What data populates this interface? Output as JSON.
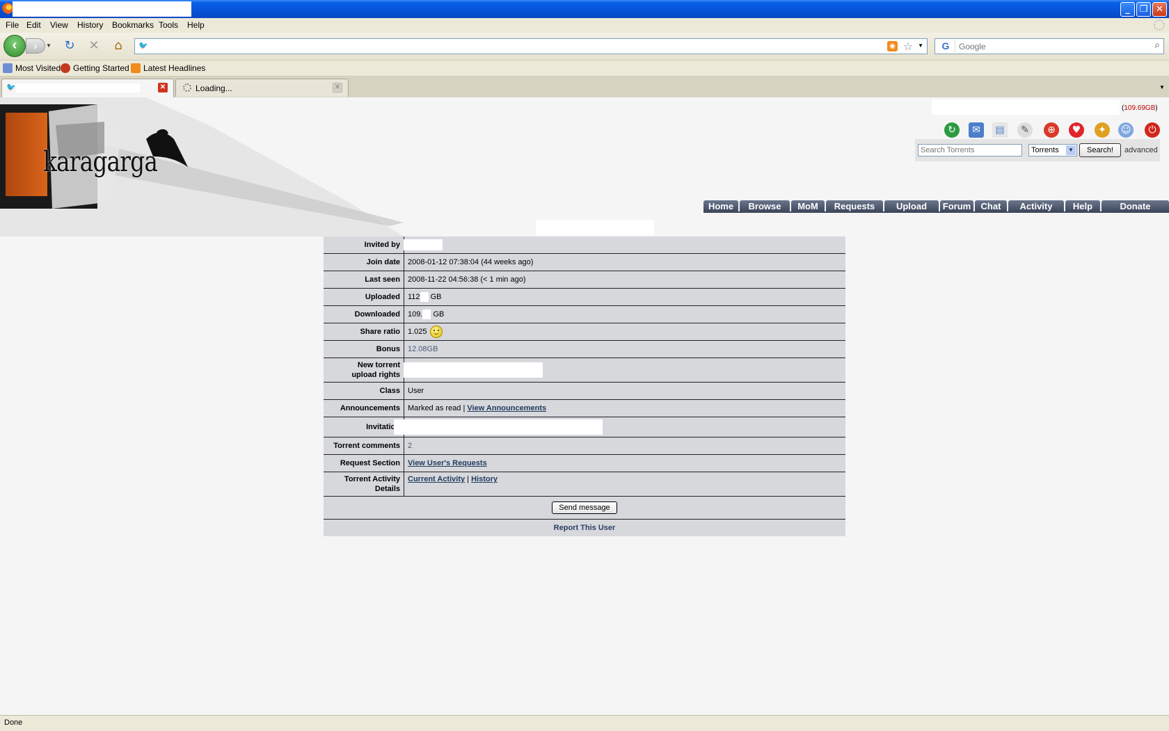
{
  "menu": [
    "File",
    "Edit",
    "View",
    "History",
    "Bookmarks",
    "Tools",
    "Help"
  ],
  "window_buttons": {
    "minimize": "_",
    "maximize": "❐",
    "close": "✕"
  },
  "nav": {
    "back": "‹",
    "forward": "›",
    "reload": "↻",
    "stop": "✕",
    "home": "⌂"
  },
  "search_placeholder": "Google",
  "bookmarks": [
    "Most Visited",
    "Getting Started",
    "Latest Headlines"
  ],
  "tabs": [
    {
      "label": ""
    },
    {
      "label": "Loading..."
    }
  ],
  "site": {
    "logo": "karagarga",
    "ratio_info": "109.69GB",
    "search_placeholder": "Search Torrents",
    "search_scope": "Torrents",
    "search_button": "Search!",
    "advanced": "advanced",
    "icons": [
      "refresh-icon",
      "bookmark-icon",
      "profile-card-icon",
      "messages-icon",
      "lifebuoy-icon",
      "heart-icon",
      "friends-icon",
      "users-icon",
      "logout-icon"
    ],
    "nav_tabs": [
      "Home",
      "Browse",
      "MoM",
      "Requests",
      "Upload",
      "Forum",
      "Chat",
      "Activity",
      "Help",
      "Donate"
    ]
  },
  "profile": {
    "invited_by_label": "Invited by",
    "join_date_label": "Join date",
    "join_date": "2008-01-12 07:38:04 (44 weeks ago)",
    "last_seen_label": "Last seen",
    "last_seen": "2008-11-22 04:56:38 (< 1 min ago)",
    "uploaded_label": "Uploaded",
    "uploaded_prefix": "112",
    "uploaded_unit": "GB",
    "downloaded_label": "Downloaded",
    "downloaded_prefix": "109.",
    "downloaded_unit": "GB",
    "share_ratio_label": "Share ratio",
    "share_ratio": "1.025",
    "bonus_label": "Bonus",
    "bonus": "12.08GB",
    "upload_rights_label_1": "New torrent",
    "upload_rights_label_2": "upload rights",
    "class_label": "Class",
    "class": "User",
    "announcements_label": "Announcements",
    "announcements_status": "Marked as read |",
    "announcements_link": "View Announcements",
    "invitation_label": "Invitation",
    "torrent_comments_label": "Torrent comments",
    "torrent_comments": "2",
    "request_section_label": "Request Section",
    "request_section_link": "View User's Requests",
    "activity_label_1": "Torrent Activity",
    "activity_label_2": "Details",
    "activity_current": "Current Activity",
    "activity_sep": "|",
    "activity_history": "History",
    "send_message": "Send message",
    "report_user": "Report This User"
  },
  "status": "Done"
}
